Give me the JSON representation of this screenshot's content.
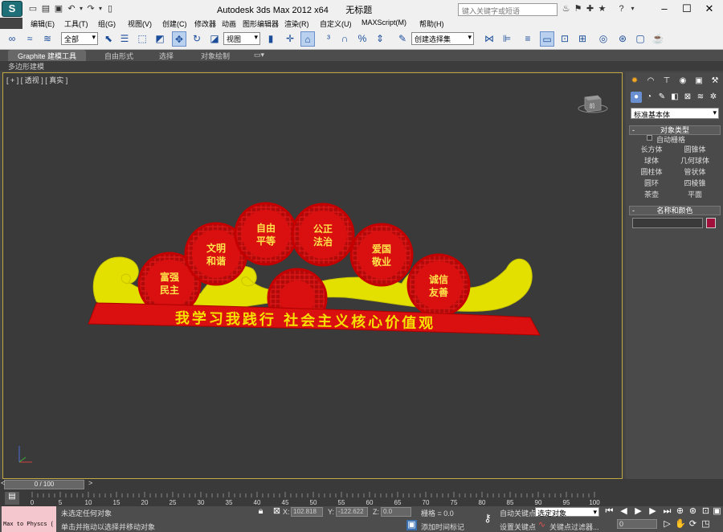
{
  "window": {
    "title": "Autodesk 3ds Max  2012 x64",
    "doc_name": "无标题",
    "search_placeholder": "键入关键字或短语"
  },
  "menus": [
    "编辑(E)",
    "工具(T)",
    "组(G)",
    "视图(V)",
    "创建(C)",
    "修改器",
    "动画",
    "图形编辑器",
    "渲染(R)",
    "自定义(U)",
    "MAXScript(M)",
    "帮助(H)"
  ],
  "toolbar": {
    "selection_filter": "全部",
    "ref_coord": "视图",
    "named_selection": "创建选择集"
  },
  "ribbon": {
    "tabs": [
      "Graphite 建模工具",
      "自由形式",
      "选择",
      "对象绘制"
    ],
    "sub_panel": "多边形建模"
  },
  "viewport": {
    "label": "[ + ] [ 透视 ] [ 真实 ]",
    "viewcube_text": "前",
    "scene": {
      "banner_text": "我学习我践行 社会主义核心价值观",
      "badges": [
        {
          "line1": "富强",
          "line2": "民主"
        },
        {
          "line1": "文明",
          "line2": "和谐"
        },
        {
          "line1": "自由",
          "line2": "平等"
        },
        {
          "line1": "公正",
          "line2": "法治"
        },
        {
          "line1": "爱国",
          "line2": "敬业"
        },
        {
          "line1": "诚信",
          "line2": "友善"
        }
      ],
      "colors": {
        "red": "#d9100f",
        "yellow": "#e3e000",
        "text_yellow": "#ffe34a",
        "banner_text": "#f5e000"
      }
    }
  },
  "command_panel": {
    "category_dropdown": "标准基本体",
    "object_type_title": "对象类型",
    "autogrid_label": "自动栅格",
    "object_buttons": [
      "长方体",
      "圆锥体",
      "球体",
      "几何球体",
      "圆柱体",
      "管状体",
      "圆环",
      "四棱锥",
      "茶壶",
      "平面"
    ],
    "name_color_title": "名称和颜色",
    "object_color": "#a0103a"
  },
  "timeline": {
    "slider_label": "0 / 100",
    "ticks": [
      "0",
      "5",
      "10",
      "15",
      "20",
      "25",
      "30",
      "35",
      "40",
      "45",
      "50",
      "55",
      "60",
      "65",
      "70",
      "75",
      "80",
      "85",
      "90",
      "95",
      "100"
    ]
  },
  "status": {
    "maxscript_label": "Max to Physcs (",
    "status_line1": "未选定任何对象",
    "status_line2": "单击并拖动以选择并移动对象",
    "x_label": "X:",
    "x_value": "102.818",
    "y_label": "Y:",
    "y_value": "-122.622",
    "z_label": "Z:",
    "z_value": "0.0",
    "grid_label": "栅格 = 0.0",
    "add_time_tag": "添加时间标记",
    "auto_key": "自动关键点",
    "key_mode_select": "选定对象",
    "set_key": "设置关键点",
    "key_filters": "关键点过滤器...",
    "current_frame": "0"
  }
}
